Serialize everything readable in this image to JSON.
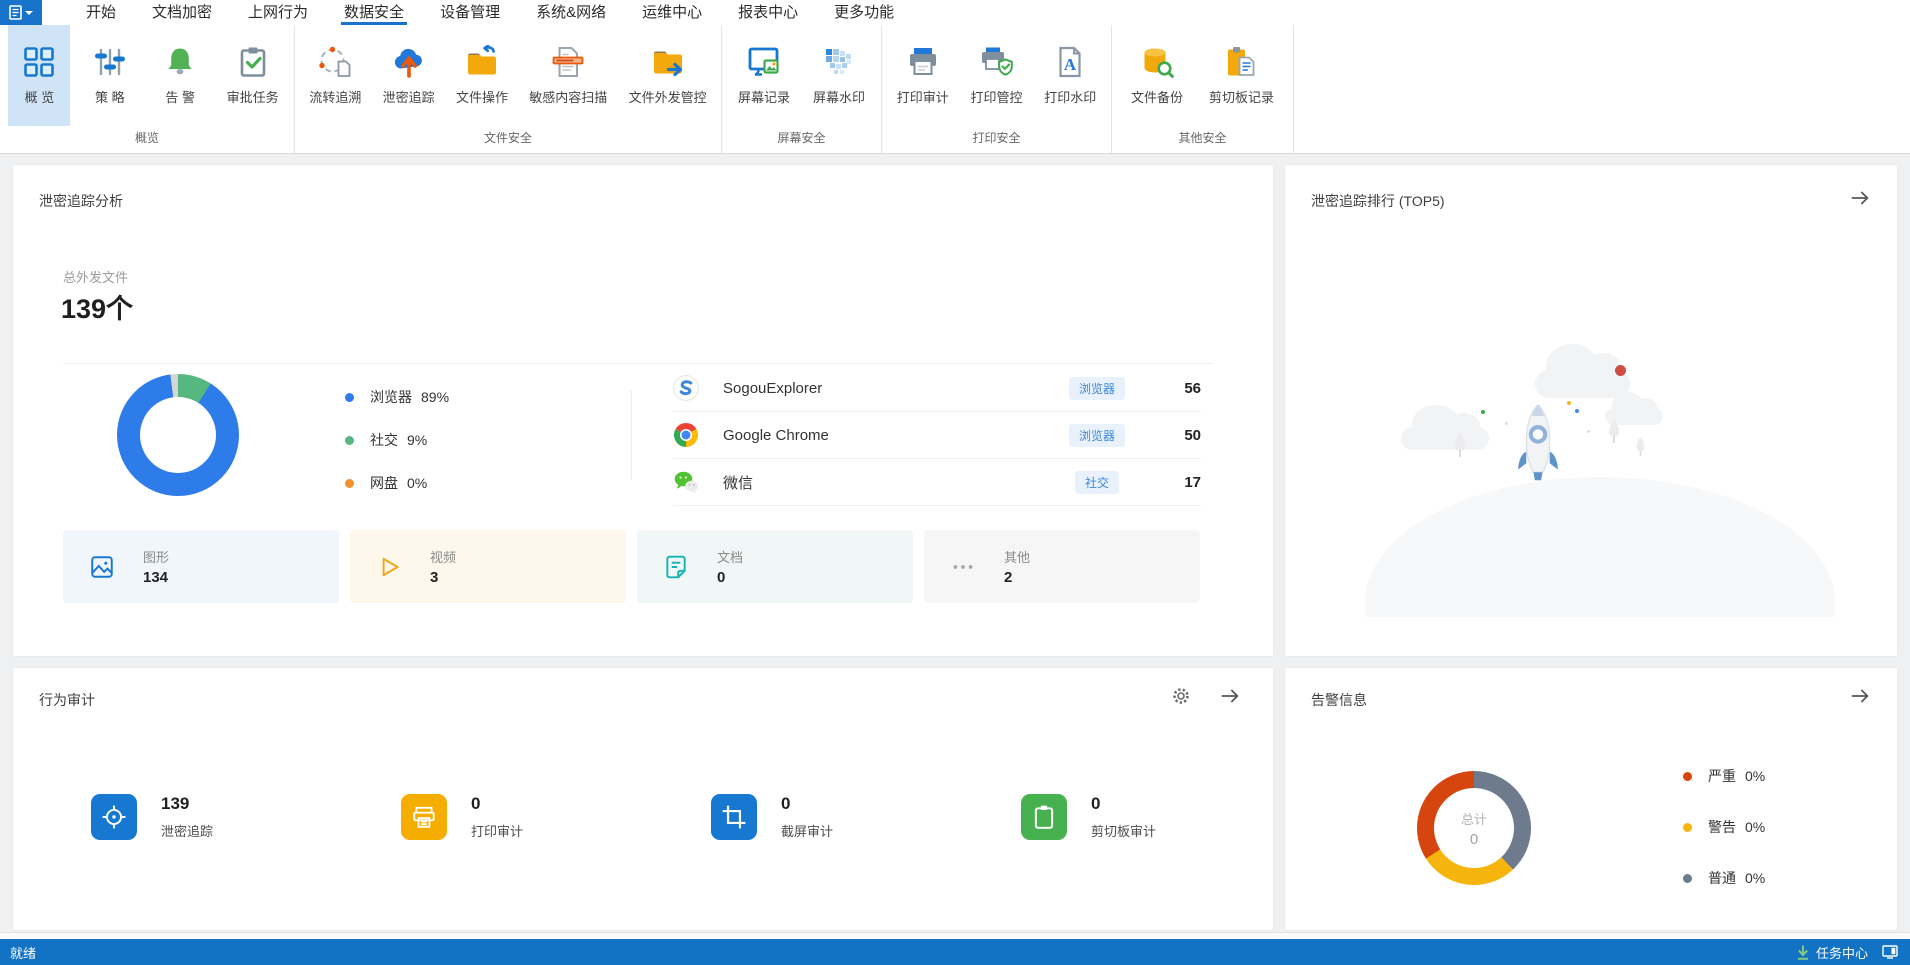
{
  "menu": {
    "tabs": [
      {
        "label": "开始"
      },
      {
        "label": "文档加密"
      },
      {
        "label": "上网行为"
      },
      {
        "label": "数据安全",
        "active": true
      },
      {
        "label": "设备管理"
      },
      {
        "label": "系统&网络"
      },
      {
        "label": "运维中心"
      },
      {
        "label": "报表中心"
      },
      {
        "label": "更多功能"
      }
    ]
  },
  "ribbon": {
    "groups": [
      {
        "label": "概览",
        "items": [
          {
            "label": "概 览",
            "icon": "overview-grid-icon",
            "selected": true
          },
          {
            "label": "策 略",
            "icon": "policy-sliders-icon"
          },
          {
            "label": "告 警",
            "icon": "alarm-bell-icon"
          },
          {
            "label": "审批任务",
            "icon": "approval-clipboard-icon"
          }
        ]
      },
      {
        "label": "文件安全",
        "items": [
          {
            "label": "流转追溯",
            "icon": "trace-cycle-icon"
          },
          {
            "label": "泄密追踪",
            "icon": "leak-trace-cloud-icon"
          },
          {
            "label": "文件操作",
            "icon": "file-operation-folder-icon"
          },
          {
            "label": "敏感内容扫描",
            "icon": "sensitive-scan-icon"
          },
          {
            "label": "文件外发管控",
            "icon": "file-outgoing-folder-icon"
          }
        ]
      },
      {
        "label": "屏幕安全",
        "items": [
          {
            "label": "屏幕记录",
            "icon": "screen-record-icon"
          },
          {
            "label": "屏幕水印",
            "icon": "screen-watermark-icon"
          }
        ]
      },
      {
        "label": "打印安全",
        "items": [
          {
            "label": "打印审计",
            "icon": "print-audit-icon"
          },
          {
            "label": "打印管控",
            "icon": "print-control-icon"
          },
          {
            "label": "打印水印",
            "icon": "print-watermark-icon"
          }
        ]
      },
      {
        "label": "其他安全",
        "items": [
          {
            "label": "文件备份",
            "icon": "file-backup-icon"
          },
          {
            "label": "剪切板记录",
            "icon": "clipboard-record-icon"
          }
        ]
      }
    ]
  },
  "panels": {
    "leak_analysis": {
      "title": "泄密追踪分析",
      "total_label": "总外发文件",
      "total_value": "139个",
      "legend": [
        {
          "label": "浏览器",
          "pct": "89%",
          "color": "#2e7cea"
        },
        {
          "label": "社交",
          "pct": "9%",
          "color": "#56b87e"
        },
        {
          "label": "网盘",
          "pct": "0%",
          "color": "#f0912d"
        }
      ],
      "apps": [
        {
          "name": "SogouExplorer",
          "tag": "浏览器",
          "value": "56",
          "icon": "sogou-browser-icon"
        },
        {
          "name": "Google Chrome",
          "tag": "浏览器",
          "value": "50",
          "icon": "chrome-browser-icon"
        },
        {
          "name": "微信",
          "tag": "社交",
          "value": "17",
          "icon": "wechat-icon"
        }
      ],
      "cards": [
        {
          "label": "图形",
          "value": "134",
          "icon": "image-file-icon",
          "bg": "#f0f6fc"
        },
        {
          "label": "视频",
          "value": "3",
          "icon": "video-file-icon",
          "bg": "#fdf7ec"
        },
        {
          "label": "文档",
          "value": "0",
          "icon": "document-file-icon",
          "bg": "#f1f7f7"
        },
        {
          "label": "其他",
          "value": "2",
          "icon": "more-files-icon",
          "bg": "#f6f6f6"
        }
      ]
    },
    "leak_rank": {
      "title": "泄密追踪排行 (TOP5)"
    },
    "behavior_audit": {
      "title": "行为审计",
      "stats": [
        {
          "value": "139",
          "label": "泄密追踪",
          "icon": "target-icon",
          "color": "#1778d2"
        },
        {
          "value": "0",
          "label": "打印审计",
          "icon": "print-receipt-icon",
          "color": "#f5ad00"
        },
        {
          "value": "0",
          "label": "截屏审计",
          "icon": "crop-icon",
          "color": "#1778d2"
        },
        {
          "value": "0",
          "label": "剪切板审计",
          "icon": "clipboard-icon",
          "color": "#47b14f"
        }
      ]
    },
    "alerts": {
      "title": "告警信息",
      "center_label": "总计",
      "center_value": "0",
      "legend": [
        {
          "label": "严重",
          "pct": "0%",
          "color": "#d5450d"
        },
        {
          "label": "警告",
          "pct": "0%",
          "color": "#f6b50c"
        },
        {
          "label": "普通",
          "pct": "0%",
          "color": "#6d7b8d"
        }
      ]
    }
  },
  "statusbar": {
    "left": "就绪",
    "task_center": "任务中心"
  },
  "chart_data": [
    {
      "type": "pie",
      "title": "泄密追踪分析 外发渠道占比",
      "segments": [
        {
          "label": "社交",
          "pct": 9,
          "color": "#56b87e"
        },
        {
          "label": "浏览器",
          "pct": 89,
          "color": "#2e7cea"
        },
        {
          "label": "其他",
          "pct": 2,
          "color": "#d6d6d6"
        }
      ],
      "legend": [
        {
          "label": "浏览器",
          "pct": 89
        },
        {
          "label": "社交",
          "pct": 9
        },
        {
          "label": "网盘",
          "pct": 0
        }
      ],
      "legend_position": "right"
    },
    {
      "type": "pie",
      "title": "告警信息",
      "segments": [
        {
          "label": "普通",
          "pct": 38,
          "color": "#6d7b8d"
        },
        {
          "label": "警告",
          "pct": 28,
          "color": "#f6b50c"
        },
        {
          "label": "严重",
          "pct": 34,
          "color": "#d5450d"
        }
      ],
      "center_label": "总计",
      "center_value": 0,
      "legend_position": "right"
    }
  ]
}
